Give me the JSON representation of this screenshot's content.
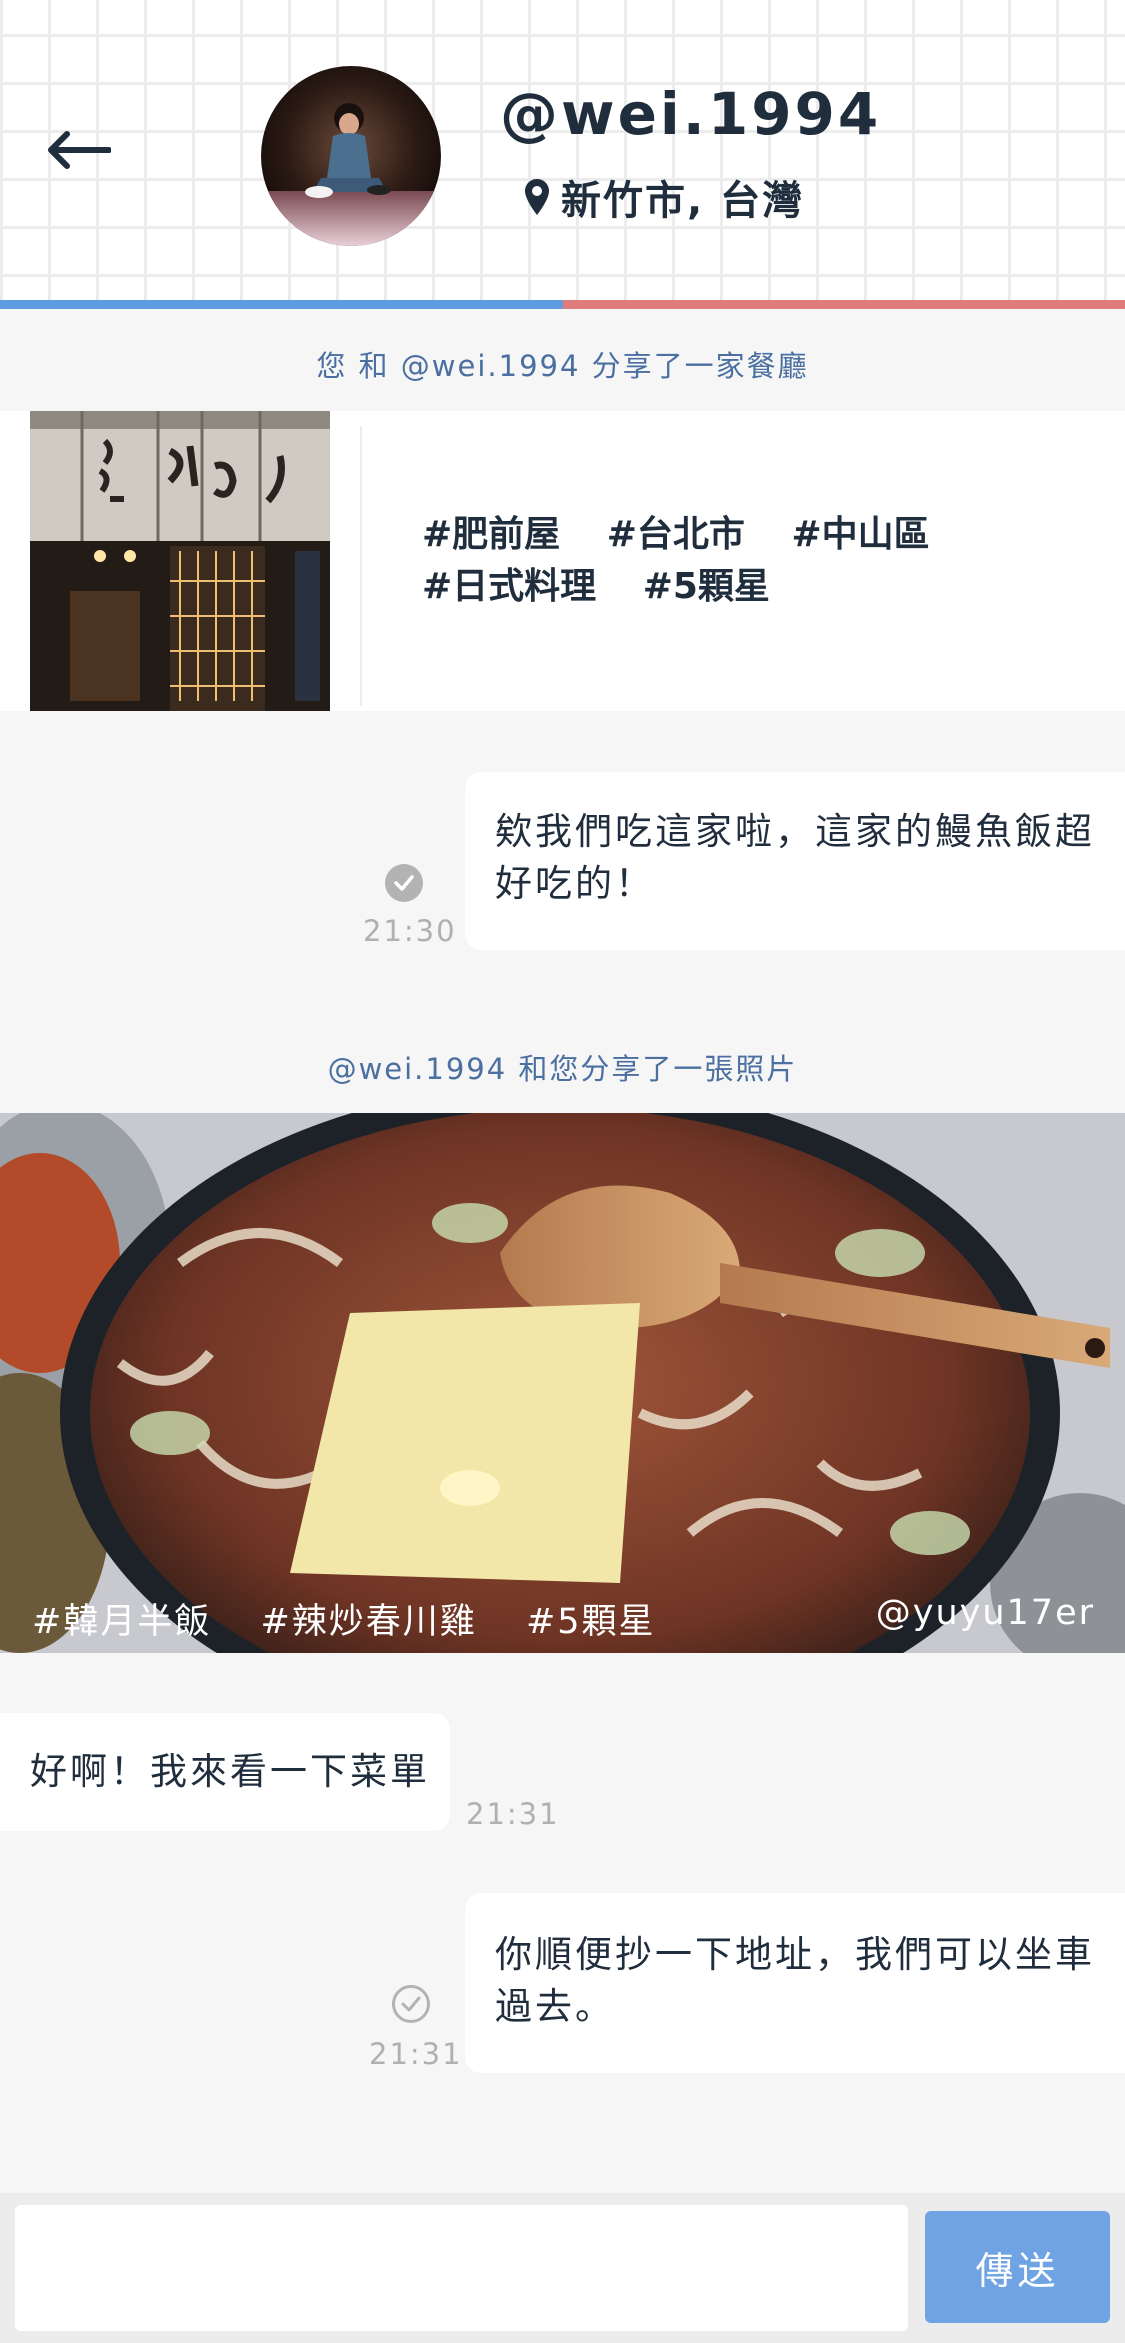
{
  "header": {
    "back_icon": "arrow-left-icon",
    "username": "@wei.1994",
    "location_icon": "map-pin-icon",
    "location": "新竹市, 台灣"
  },
  "colors": {
    "accent_blue": "#5d9ddf",
    "accent_red": "#e07c7c",
    "send_button": "#6fa3e3",
    "text_dark": "#1f2d3d",
    "notice_text": "#4a6fa0"
  },
  "progress": {
    "left_fraction": 0.5
  },
  "chat": {
    "notice_restaurant": "您 和 @wei.1994 分享了一家餐廳",
    "restaurant_card": {
      "tags": [
        "#肥前屋",
        "#台北市",
        "#中山區",
        "#日式料理",
        "#5顆星"
      ]
    },
    "msg1": {
      "text": "欸我們吃這家啦，這家的鰻魚飯超好吃的！",
      "time": "21:30",
      "status": "read"
    },
    "notice_photo": "@wei.1994 和您分享了一張照片",
    "photo": {
      "tags": [
        "#韓月半飯",
        "#辣炒春川雞",
        "#5顆星"
      ],
      "credit": "@yuyu17er"
    },
    "msg2": {
      "text": "好啊！我來看一下菜單",
      "time": "21:31"
    },
    "msg3": {
      "text": "你順便抄一下地址，我們可以坐車過去。",
      "time": "21:31",
      "status": "sent"
    }
  },
  "composer": {
    "placeholder": "",
    "send_label": "傳送"
  }
}
